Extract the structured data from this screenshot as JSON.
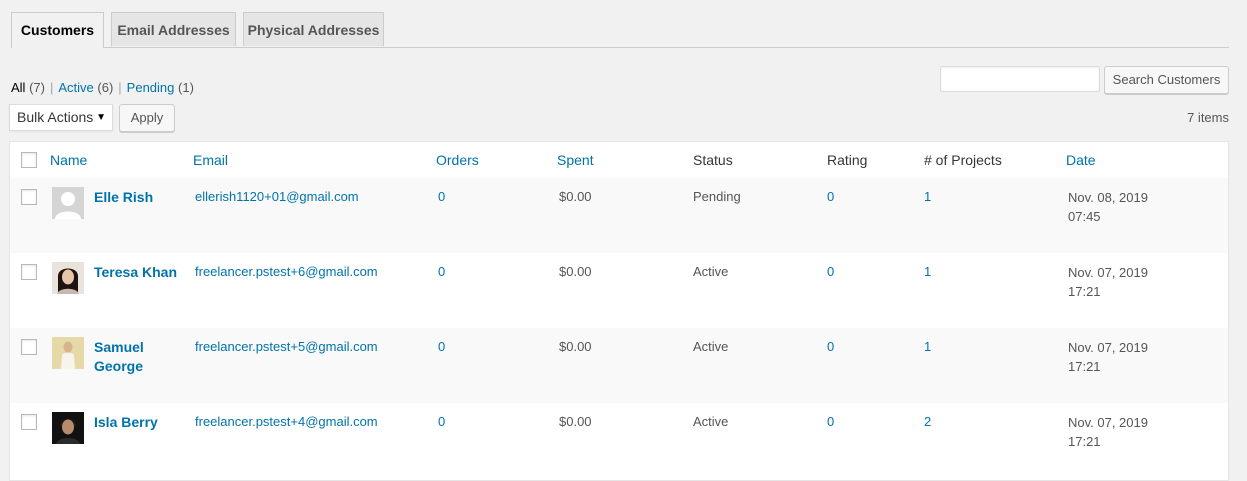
{
  "tabs": [
    {
      "label": "Customers",
      "active": true
    },
    {
      "label": "Email Addresses",
      "active": false
    },
    {
      "label": "Physical Addresses",
      "active": false
    }
  ],
  "views": {
    "all": {
      "label": "All",
      "count": "(7)"
    },
    "active": {
      "label": "Active",
      "count": "(6)"
    },
    "pending": {
      "label": "Pending",
      "count": "(1)"
    },
    "separator": "|"
  },
  "search": {
    "button_label": "Search Customers",
    "value": ""
  },
  "bulk": {
    "selected": "Bulk Actions",
    "apply_label": "Apply"
  },
  "items_count": "7 items",
  "columns": {
    "name": "Name",
    "email": "Email",
    "orders": "Orders",
    "spent": "Spent",
    "status": "Status",
    "rating": "Rating",
    "projects": "# of Projects",
    "date": "Date"
  },
  "rows": [
    {
      "name": "Elle Rish",
      "email": "ellerish1120+01@gmail.com",
      "orders": "0",
      "spent": "$0.00",
      "status": "Pending",
      "rating": "0",
      "projects": "1",
      "date": "Nov. 08, 2019",
      "time": "07:45",
      "avatar": "default-avatar-icon"
    },
    {
      "name": "Teresa Khan",
      "email": "freelancer.pstest+6@gmail.com",
      "orders": "0",
      "spent": "$0.00",
      "status": "Active",
      "rating": "0",
      "projects": "1",
      "date": "Nov. 07, 2019",
      "time": "17:21",
      "avatar": "user-photo"
    },
    {
      "name": "Samuel George",
      "email": "freelancer.pstest+5@gmail.com",
      "orders": "0",
      "spent": "$0.00",
      "status": "Active",
      "rating": "0",
      "projects": "1",
      "date": "Nov. 07, 2019",
      "time": "17:21",
      "avatar": "user-photo"
    },
    {
      "name": "Isla Berry",
      "email": "freelancer.pstest+4@gmail.com",
      "orders": "0",
      "spent": "$0.00",
      "status": "Active",
      "rating": "0",
      "projects": "2",
      "date": "Nov. 07, 2019",
      "time": "17:21",
      "avatar": "user-photo"
    }
  ],
  "colors": {
    "link": "#0073aa",
    "background": "#f1f1f1",
    "alt_row": "#f9f9f9"
  }
}
